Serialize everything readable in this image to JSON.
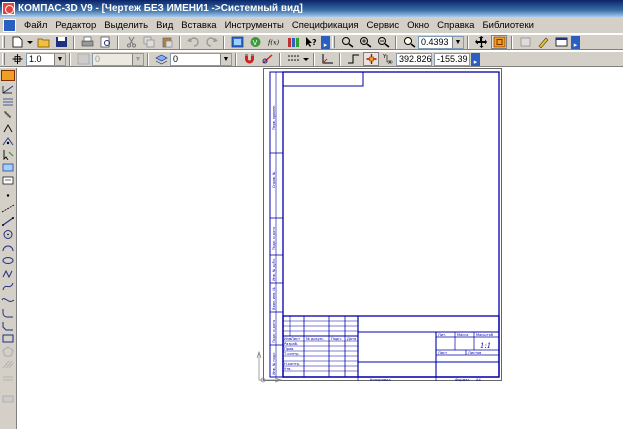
{
  "window": {
    "title": "КОМПАС-3D V9 - [Чертеж БЕЗ ИМЕНИ1 ->Системный вид]"
  },
  "menu": [
    "Файл",
    "Редактор",
    "Выделить",
    "Вид",
    "Вставка",
    "Инструменты",
    "Спецификация",
    "Сервис",
    "Окно",
    "Справка",
    "Библиотеки"
  ],
  "toolbar": {
    "zoom_value": "0.4393"
  },
  "props_toolbar": {
    "line_width": "1.0",
    "style_value": "0",
    "layer_value": "0",
    "coord_x": "392.826",
    "coord_y": "-155.39"
  },
  "drawing": {
    "litera": "Лит.",
    "mass": "Масса",
    "scale_label": "Масштаб",
    "scale_value": "1:1",
    "sheet": "Лист",
    "sheets": "Листов",
    "change": "Изм.",
    "list": "Лист",
    "doc_no": "№ докум.",
    "sign": "Подп.",
    "date": "Дата",
    "developed": "Разраб.",
    "checked": "Пров.",
    "t_control": "Т.контр.",
    "n_control": "Н.контр.",
    "approved": "Утв.",
    "copied": "Копировал",
    "format_label": "Формат",
    "format_value": "A4",
    "side_labels": [
      "Перв. примен.",
      "Справ. №",
      "Подп. и дата",
      "Инв. № дубл.",
      "Взам. инв. №",
      "Подп. и дата",
      "Инв. № подл."
    ]
  },
  "colors": {
    "frame": "#0000a8",
    "chrome": "#d4d0c8",
    "titlebar": "#0a246a"
  }
}
